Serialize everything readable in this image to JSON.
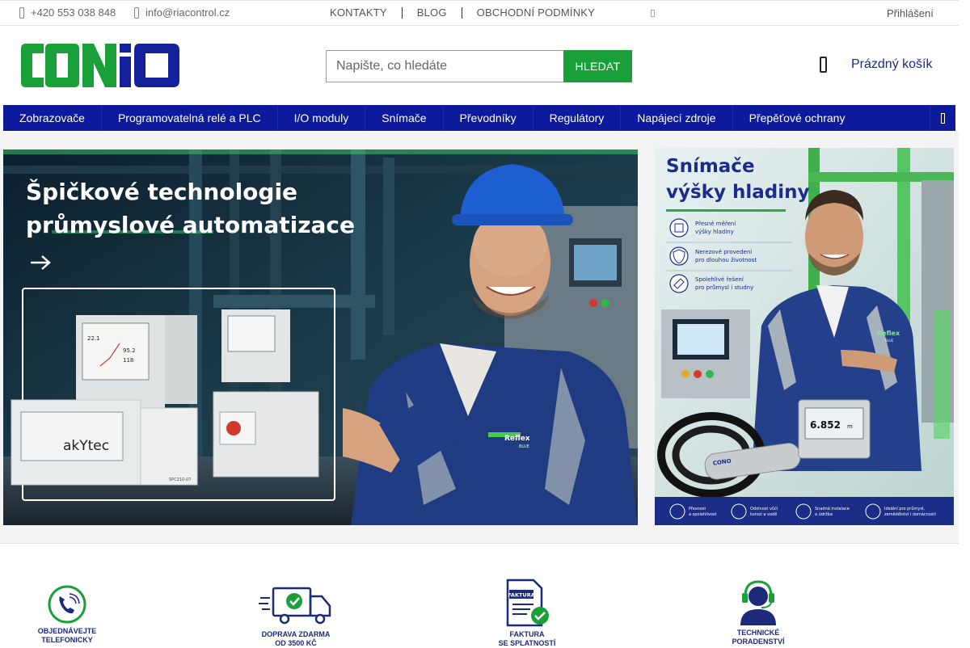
{
  "topbar": {
    "phone": "+420 553 038 848",
    "email": "info@riacontrol.cz",
    "links": [
      "KONTAKTY",
      "BLOG",
      "OBCHODNÍ PODMÍNKY"
    ],
    "login": "Přihlášení"
  },
  "header": {
    "logo_text": "CONiO",
    "search_placeholder": "Napište, co hledáte",
    "search_button": "HLEDAT",
    "cart_label": "Prázdný košík"
  },
  "nav": {
    "items": [
      "Zobrazovače",
      "Programovatelná relé a PLC",
      "I/O moduly",
      "Snímače",
      "Převodníky",
      "Regulátory",
      "Napájecí zdroje",
      "Přepěťové ochrany"
    ]
  },
  "banner_main": {
    "headline_line1": "Špičkové technologie",
    "headline_line2": "průmyslové automatizace",
    "arrow_icon": "arrow-right-icon",
    "device_brand": "akYtec",
    "device_model": "SPC210-07",
    "display_value_1": "22.1",
    "display_value_2": "95.2",
    "display_value_3": "118",
    "uniform_brand": "Reflex",
    "uniform_sub": "BLUE"
  },
  "banner_side": {
    "headline_line1": "Snímače",
    "headline_line2": "výšky hladiny",
    "features": [
      {
        "icon": "gauge-icon",
        "line1": "Přesné měření",
        "line2": "výšky hladiny"
      },
      {
        "icon": "shield-icon",
        "line1": "Nerezové provedení",
        "line2": "pro dlouhou životnost"
      },
      {
        "icon": "tag-icon",
        "line1": "Spolehlivé řešení",
        "line2": "pro průmysl i studny"
      }
    ],
    "sensor_brand": "CONO",
    "display_value": "6.852",
    "display_unit": "m",
    "uniform_brand": "Reflex",
    "uniform_sub": "BLUE",
    "footer_items": [
      {
        "icon": "target-icon",
        "line1": "Přesnost",
        "line2": "a spolehlivost"
      },
      {
        "icon": "drop-icon",
        "line1": "Odolnost vůči",
        "line2": "korozi a vodě"
      },
      {
        "icon": "gear-icon",
        "line1": "Snadná instalace",
        "line2": "a údržba"
      },
      {
        "icon": "chart-icon",
        "line1": "Ideální pro průmysl,",
        "line2": "zemědělství i domácnosti"
      }
    ]
  },
  "benefits": [
    {
      "icon": "phone-icon",
      "line1": "OBJEDNÁVEJTE",
      "line2": "TELEFONICKY"
    },
    {
      "icon": "truck-icon",
      "line1": "DOPRAVA ZDARMA",
      "line2": "OD 3500 KČ"
    },
    {
      "icon": "invoice-icon",
      "badge": "FAKTURA",
      "line1": "FAKTURA",
      "line2": "SE SPLATNOSTÍ"
    },
    {
      "icon": "headset-icon",
      "line1": "TECHNICKÉ",
      "line2": "PORADENSTVÍ"
    }
  ],
  "colors": {
    "brand_green": "#1aa039",
    "brand_blue": "#0d1a9c",
    "logo_blue": "#13209a"
  }
}
